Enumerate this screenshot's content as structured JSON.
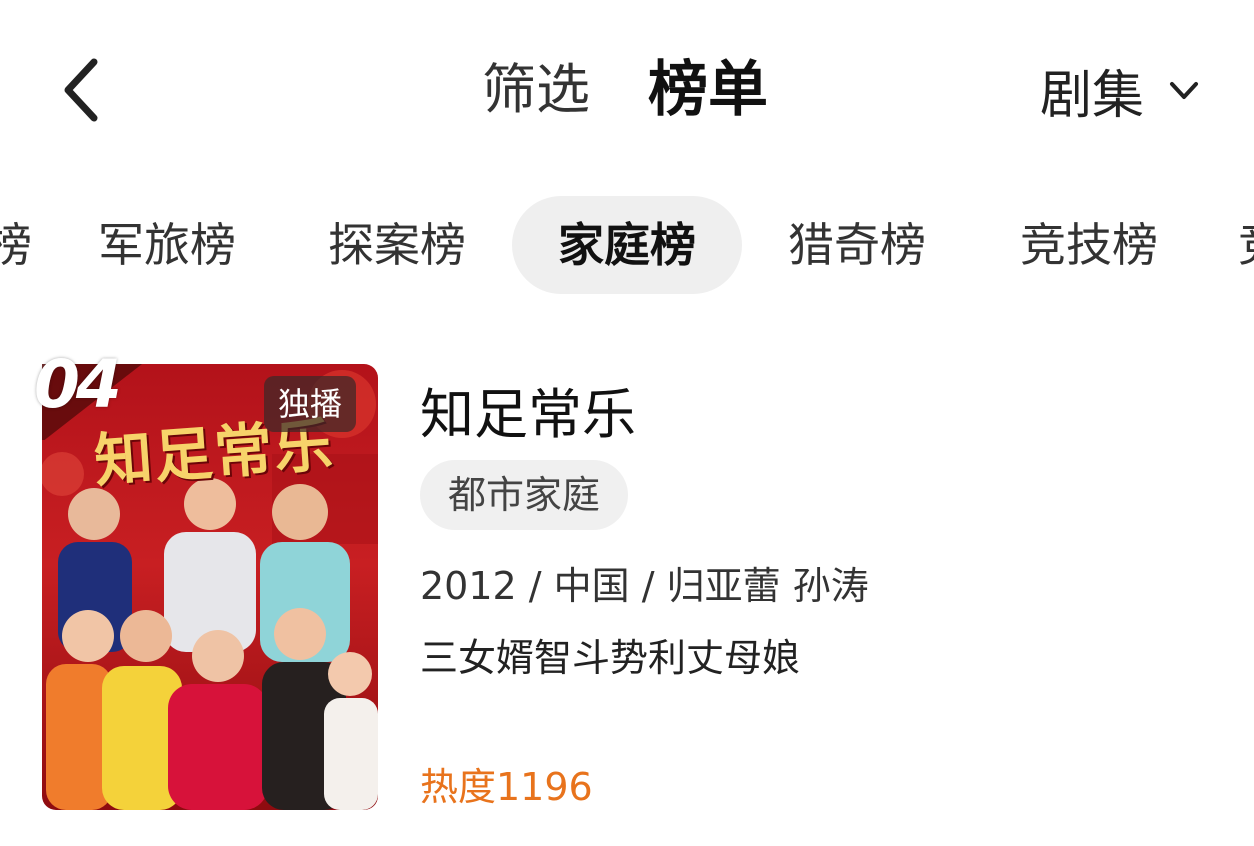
{
  "header": {
    "back_icon": "chevron-left-icon",
    "tab_filter": "筛选",
    "tab_ranking": "榜单",
    "category": "剧集",
    "category_icon": "chevron-down-icon"
  },
  "rank_tabs": {
    "clipped_left": "榜",
    "items": [
      "军旅榜",
      "探案榜",
      "家庭榜",
      "猎奇榜",
      "竞技榜"
    ],
    "clipped_right": "竞",
    "active": "家庭榜"
  },
  "item": {
    "rank": "04",
    "poster_title": "知足常乐",
    "badge": "独播",
    "title": "知足常乐",
    "tag": "都市家庭",
    "meta": "2012 / 中国 / 归亚蕾 孙涛",
    "description": "三女婿智斗势利丈母娘",
    "heat": "热度1196"
  },
  "colors": {
    "heat": "#e8731c",
    "active_tab_bg": "#efefef",
    "tag_bg": "#f0f0f0"
  }
}
